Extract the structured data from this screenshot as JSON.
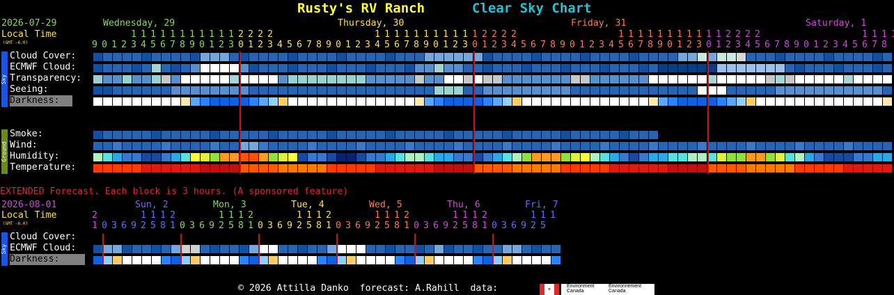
{
  "title": {
    "site": "Rusty's RV Ranch",
    "chart": "Clear Sky Chart"
  },
  "main": {
    "date": "2026-07-29",
    "local_time": "Local Time",
    "gmt": "(GMT -6.0)",
    "days": [
      {
        "label": "Wednesday, 29",
        "color": "#8cd95a"
      },
      {
        "label": "Thursday, 30",
        "color": "#ffe24a"
      },
      {
        "label": "Friday, 31",
        "color": "#ff7a4a"
      },
      {
        "label": "Saturday, 1",
        "color": "#d14ad9"
      }
    ],
    "hours_tens": "1 1 1 1 1 1 1 1 1 1 1 2 2 2 2",
    "hours_units": "9 0 1 2 3 4 5 6 7 8 9 0 1 2 3 0 1 2 3 4 5 6 7 8 9 0 1 2 3 4 5 6 7 8 9 0 1 2 3",
    "sky_side": "Sky",
    "ground_side": "Ground",
    "rows": {
      "cloud_cover": "Cloud Cover:",
      "ecmwf": "ECMWF Cloud:",
      "transparency": "Transparency:",
      "seeing": "Seeing:",
      "darkness": "Darkness:",
      "smoke": "Smoke:",
      "wind": "Wind:",
      "humidity": "Humidity:",
      "temperature": "Temperature:"
    }
  },
  "extended": {
    "banner": "EXTENDED Forecast. Each block is 3 hours. (A sponsored feature)",
    "date": "2026-08-01",
    "local_time": "Local Time",
    "gmt": "(GMT -6.0)",
    "days": [
      {
        "label": "Sun, 2",
        "color": "#6a6aff"
      },
      {
        "label": "Mon, 3",
        "color": "#8cd95a"
      },
      {
        "label": "Tue, 4",
        "color": "#ffe24a"
      },
      {
        "label": "Wed, 5",
        "color": "#ff7a4a"
      },
      {
        "label": "Thu, 6",
        "color": "#d14ad9"
      },
      {
        "label": "Fri, 7",
        "color": "#6a6aff"
      }
    ],
    "rows": {
      "cloud_cover": "Cloud Cover:",
      "ecmwf": "ECMWF Cloud:",
      "darkness": "Darkness:"
    },
    "sky_side": "Sky"
  },
  "footer": {
    "copyright": "© 2026 Attilla Danko  forecast: A.Rahill  data:",
    "env1": "Environment Canada",
    "env2": "Environnement Canada"
  },
  "colors": {
    "title_site": "#ffff33",
    "title_chart": "#22c4d8",
    "label_text": "#ffffff",
    "date_text": "#8cd95a",
    "local_time": "#ffe24a",
    "red_banner": "#e0282a",
    "marker": "#c8141e",
    "sky_bar": "#1856e0",
    "ground_bar": "#6a8a1e"
  }
}
